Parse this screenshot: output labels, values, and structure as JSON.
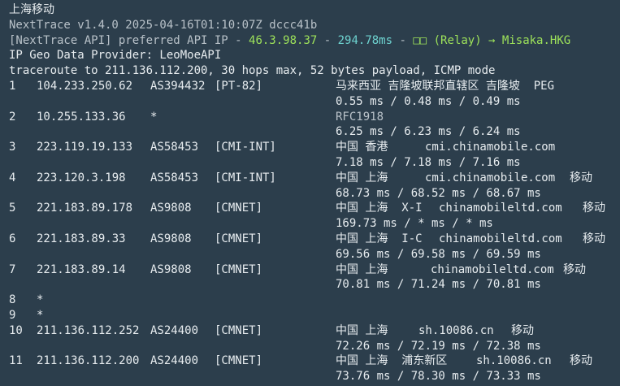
{
  "header": {
    "line1": "上海移动",
    "line2": "NextTrace v1.4.0 2025-04-16T01:10:07Z dccc41b",
    "api_prefix": "[NextTrace API] preferred API IP - ",
    "api_ip": "46.3.98.37",
    "api_sep1": " - ",
    "api_ms": "294.78ms",
    "api_sep2": " - ",
    "api_relay": "□□ (Relay) → Misaka.HKG",
    "line4": "IP Geo Data Provider: LeoMoeAPI",
    "line5": "traceroute to 211.136.112.200, 30 hops max, 52 bytes payload, ICMP mode"
  },
  "hops": [
    {
      "num": "1",
      "ip": "104.233.250.62",
      "asn": "AS394432",
      "tag": "[PT-82]",
      "geo": "马来西亚 吉隆坡联邦直辖区 吉隆坡  PEG",
      "domain": "",
      "isp": "",
      "latency": "0.55 ms / 0.48 ms / 0.49 ms"
    },
    {
      "num": "2",
      "ip": "10.255.133.36",
      "asn": "*",
      "tag": "",
      "geo": "RFC1918",
      "domain": "",
      "isp": "",
      "latency": "6.25 ms / 6.23 ms / 6.24 ms"
    },
    {
      "num": "3",
      "ip": "223.119.19.133",
      "asn": "AS58453",
      "tag": "[CMI-INT]",
      "geo": "中国 香港",
      "domain": "cmi.chinamobile.com",
      "isp": "",
      "latency": "7.18 ms / 7.18 ms / 7.16 ms"
    },
    {
      "num": "4",
      "ip": "223.120.3.198",
      "asn": "AS58453",
      "tag": "[CMI-INT]",
      "geo": "中国 上海",
      "domain": "cmi.chinamobile.com",
      "isp": "移动",
      "latency": "68.73 ms / 68.52 ms / 68.67 ms"
    },
    {
      "num": "5",
      "ip": "221.183.89.178",
      "asn": "AS9808",
      "tag": "[CMNET]",
      "geo": "中国 上海  X-I",
      "domain": "chinamobileltd.com",
      "isp": "移动",
      "latency": "169.73 ms / * ms / * ms"
    },
    {
      "num": "6",
      "ip": "221.183.89.33",
      "asn": "AS9808",
      "tag": "[CMNET]",
      "geo": "中国 上海  I-C",
      "domain": "chinamobileltd.com",
      "isp": "移动",
      "latency": "69.56 ms / 69.58 ms / 69.59 ms"
    },
    {
      "num": "7",
      "ip": "221.183.89.14",
      "asn": "AS9808",
      "tag": "[CMNET]",
      "geo": "中国 上海",
      "domain": "chinamobileltd.com",
      "isp": "移动",
      "latency": "70.81 ms / 71.24 ms / 70.81 ms"
    },
    {
      "num": "8",
      "ip": "*"
    },
    {
      "num": "9",
      "ip": "*"
    },
    {
      "num": "10",
      "ip": "211.136.112.252",
      "asn": "AS24400",
      "tag": "[CMNET]",
      "geo": "中国 上海",
      "domain": "sh.10086.cn",
      "isp": "移动",
      "latency": "72.26 ms / 72.19 ms / 72.38 ms"
    },
    {
      "num": "11",
      "ip": "211.136.112.200",
      "asn": "AS24400",
      "tag": "[CMNET]",
      "geo": "中国 上海  浦东新区",
      "domain": "sh.10086.cn",
      "isp": "移动",
      "latency": "73.76 ms / 78.30 ms / 73.33 ms"
    }
  ]
}
